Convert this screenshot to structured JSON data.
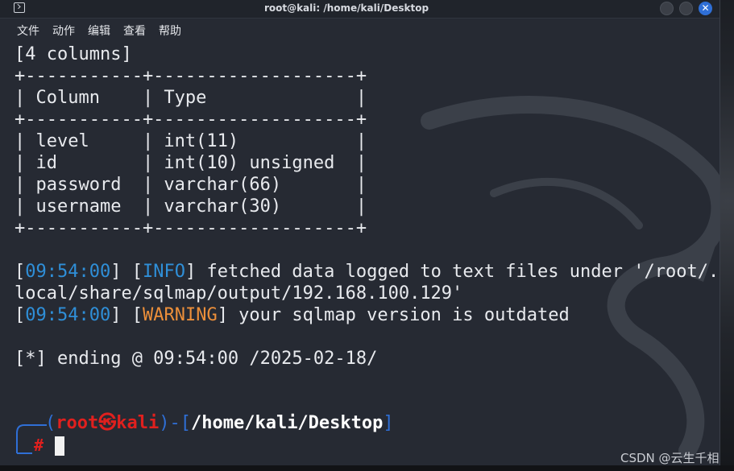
{
  "window": {
    "title": "root@kali: /home/kali/Desktop",
    "close_glyph": "✕"
  },
  "menu": [
    "文件",
    "动作",
    "编辑",
    "查看",
    "帮助"
  ],
  "terminal": {
    "table_caption": "[4 columns]",
    "border_line": "+-----------+-------------------+",
    "header_row": "| Column    | Type              |",
    "rows": [
      "| level     | int(11)           |",
      "| id        | int(10) unsigned  |",
      "| password  | varchar(66)       |",
      "| username  | varchar(30)       |"
    ],
    "log1": {
      "time": "09:54:00",
      "level": "INFO",
      "text_line1": " fetched data logged to text files under '/root/.",
      "text_line2": "local/share/sqlmap/output/192.168.100.129'"
    },
    "log2": {
      "time": "09:54:00",
      "level": "WARNING",
      "text": " your sqlmap version is outdated"
    },
    "ending": "[*] ending @ 09:54:00 /2025-02-18/",
    "prompt": {
      "user": "root",
      "at_symbol": "㉿",
      "host": "kali",
      "path": "/home/kali/Desktop",
      "symbol": "#"
    }
  },
  "watermark": "CSDN @云生千相",
  "colors": {
    "background": "#262a33",
    "info_time": "#2f8fd8",
    "info_level": "#2f8fd8",
    "warning_level": "#ec8f3a",
    "prompt_user": "#e0201e",
    "prompt_frame": "#2f6fd6"
  }
}
